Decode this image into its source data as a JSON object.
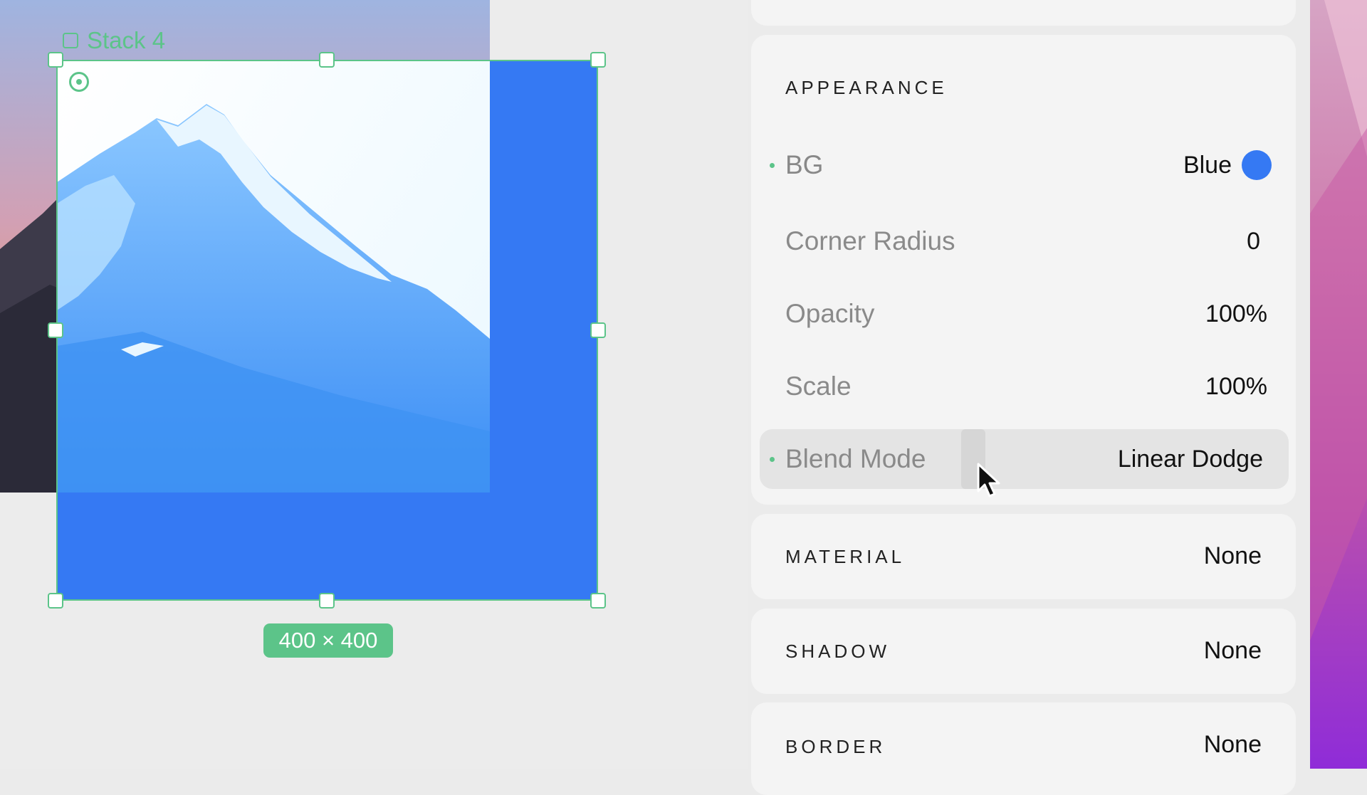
{
  "canvas": {
    "layer_name": "Stack 4",
    "size_badge": "400 × 400"
  },
  "inspector": {
    "appearance": {
      "title": "APPEARANCE",
      "bg": {
        "label": "BG",
        "value": "Blue",
        "color": "#3579f3"
      },
      "corner_radius": {
        "label": "Corner Radius",
        "value": "0"
      },
      "opacity": {
        "label": "Opacity",
        "value": "100%"
      },
      "scale": {
        "label": "Scale",
        "value": "100%"
      },
      "blend_mode": {
        "label": "Blend Mode",
        "value": "Linear Dodge"
      }
    },
    "material": {
      "title": "MATERIAL",
      "value": "None"
    },
    "shadow": {
      "title": "SHADOW",
      "value": "None"
    },
    "border": {
      "title": "BORDER",
      "value": "None"
    }
  },
  "colors": {
    "accent": "#5cc489",
    "fill_blue": "#3579f3"
  }
}
